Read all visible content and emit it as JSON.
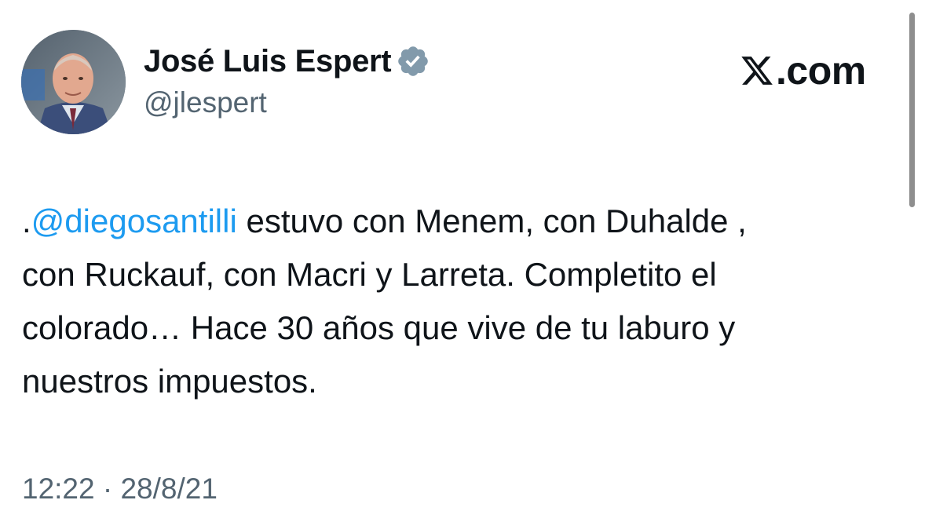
{
  "author": {
    "display_name": "José Luis Espert",
    "handle": "@jlespert",
    "verified_icon": "verified-badge-icon",
    "badge_color": "#829aab"
  },
  "brand": {
    "domain": ".com",
    "logo_icon": "x-logo-icon"
  },
  "tweet": {
    "prefix": ".",
    "mention": "@diegosantilli",
    "line1_rest": " estuvo con Menem, con Duhalde ,",
    "line2": "con Ruckauf, con Macri y Larreta. Completito el",
    "line3": "colorado… Hace 30 años que vive de tu laburo y",
    "line4": "nuestros impuestos.",
    "mention_color": "#1d9bf0"
  },
  "timestamp": "12:22 · 28/8/21"
}
